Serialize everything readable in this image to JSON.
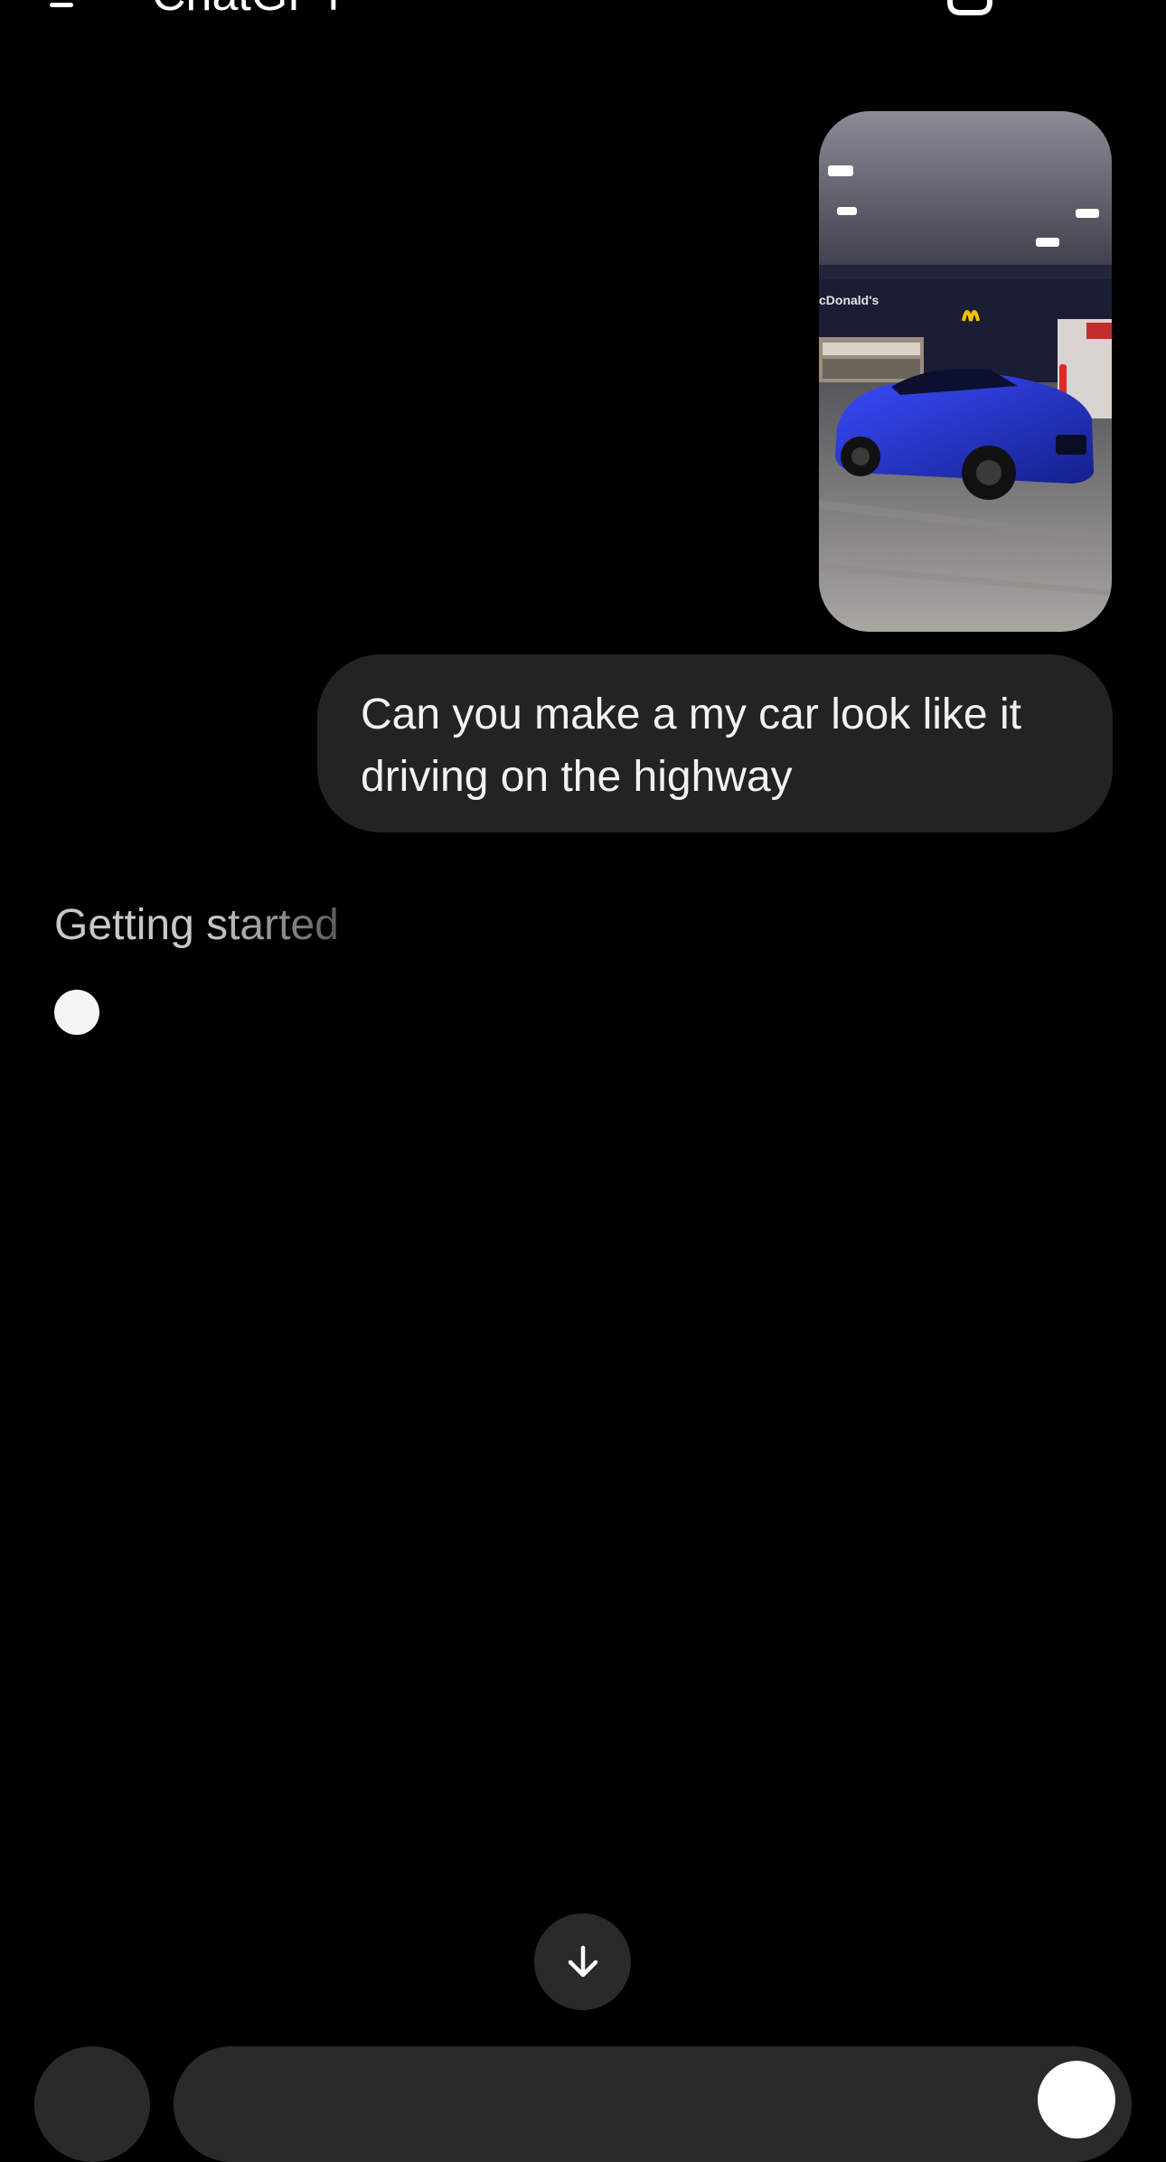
{
  "header": {
    "title": "ChatGPT",
    "menu_icon": "hamburger-menu-icon",
    "new_chat_icon": "new-chat-icon"
  },
  "conversation": {
    "user_image": {
      "kind": "photo",
      "sign_text": "cDonald's"
    },
    "user_message": "Can you make a my car look like it driving on the highway",
    "assistant_status": "Getting started"
  },
  "controls": {
    "scroll_down_icon": "arrow-down-icon",
    "plus_icon": "plus-icon",
    "composer_icon": "voice-icon"
  },
  "colors": {
    "background": "#000000",
    "bubble": "#232323",
    "car": "#1f2fb0"
  }
}
